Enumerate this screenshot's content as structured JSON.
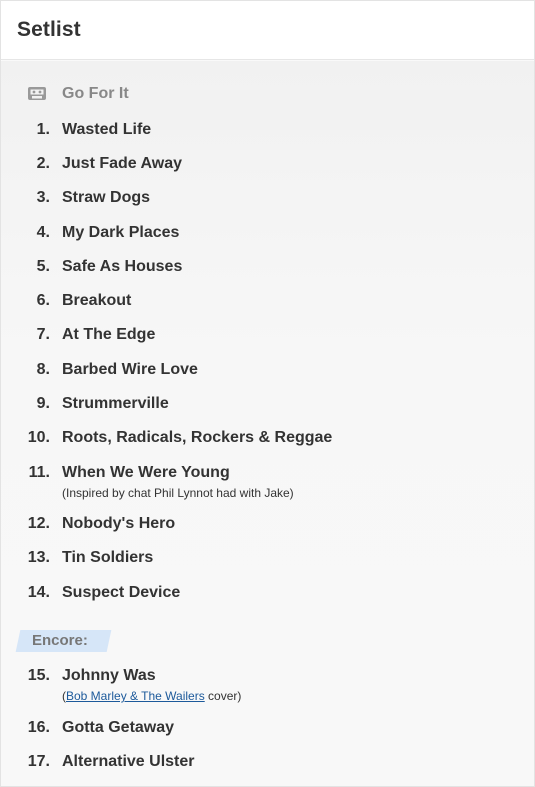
{
  "header": {
    "title": "Setlist"
  },
  "tape": {
    "label": "Go For It",
    "icon": "cassette-tape-icon"
  },
  "songs": [
    {
      "num": "1.",
      "title": "Wasted Life"
    },
    {
      "num": "2.",
      "title": "Just Fade Away"
    },
    {
      "num": "3.",
      "title": "Straw Dogs"
    },
    {
      "num": "4.",
      "title": "My Dark Places"
    },
    {
      "num": "5.",
      "title": "Safe As Houses"
    },
    {
      "num": "6.",
      "title": "Breakout"
    },
    {
      "num": "7.",
      "title": "At The Edge"
    },
    {
      "num": "8.",
      "title": "Barbed Wire Love"
    },
    {
      "num": "9.",
      "title": "Strummerville"
    },
    {
      "num": "10.",
      "title": "Roots, Radicals, Rockers & Reggae"
    },
    {
      "num": "11.",
      "title": "When We Were Young",
      "note": "(Inspired by chat Phil Lynnot had with Jake)"
    },
    {
      "num": "12.",
      "title": "Nobody's Hero"
    },
    {
      "num": "13.",
      "title": "Tin Soldiers"
    },
    {
      "num": "14.",
      "title": "Suspect Device"
    }
  ],
  "encore": {
    "label": "Encore:"
  },
  "encore_songs": [
    {
      "num": "15.",
      "title": "Johnny Was",
      "note_prefix": "(",
      "note_link": "Bob Marley & The Wailers",
      "note_suffix": " cover)"
    },
    {
      "num": "16.",
      "title": "Gotta Getaway"
    },
    {
      "num": "17.",
      "title": "Alternative Ulster"
    }
  ],
  "colors": {
    "text": "#333333",
    "muted": "#888888",
    "link": "#1d5a9b",
    "encore_bg": "#d6e6f8"
  }
}
